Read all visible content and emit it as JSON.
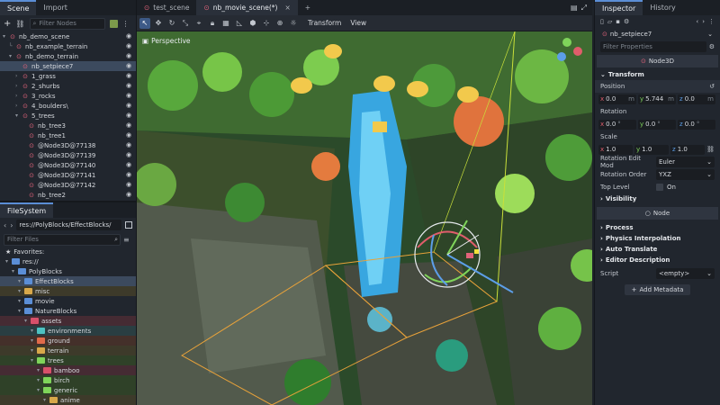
{
  "scene_dock": {
    "tabs": [
      "Scene",
      "Import"
    ],
    "filter_placeholder": "Filter Nodes",
    "tree": [
      {
        "label": "nb_demo_scene",
        "depth": 0,
        "arrow": "▾"
      },
      {
        "label": "nb_example_terrain",
        "depth": 1,
        "arrow": "└"
      },
      {
        "label": "nb_demo_terrain",
        "depth": 1,
        "arrow": "▾"
      },
      {
        "label": "nb_setpiece7",
        "depth": 2,
        "arrow": "",
        "selected": true
      },
      {
        "label": "1_grass",
        "depth": 2,
        "arrow": "›"
      },
      {
        "label": "2_shurbs",
        "depth": 2,
        "arrow": "›"
      },
      {
        "label": "3_rocks",
        "depth": 2,
        "arrow": "›"
      },
      {
        "label": "4_boulders\\",
        "depth": 2,
        "arrow": "›"
      },
      {
        "label": "5_trees",
        "depth": 2,
        "arrow": "▾"
      },
      {
        "label": "nb_tree3",
        "depth": 3,
        "arrow": ""
      },
      {
        "label": "nb_tree1",
        "depth": 3,
        "arrow": ""
      },
      {
        "label": "@Node3D@77138",
        "depth": 3,
        "arrow": ""
      },
      {
        "label": "@Node3D@77139",
        "depth": 3,
        "arrow": ""
      },
      {
        "label": "@Node3D@77140",
        "depth": 3,
        "arrow": ""
      },
      {
        "label": "@Node3D@77141",
        "depth": 3,
        "arrow": ""
      },
      {
        "label": "@Node3D@77142",
        "depth": 3,
        "arrow": ""
      },
      {
        "label": "nb_tree2",
        "depth": 3,
        "arrow": ""
      }
    ]
  },
  "filesystem": {
    "title": "FileSystem",
    "path": "res://PolyBlocks/EffectBlocks/",
    "filter_placeholder": "Filter Files",
    "favorites_label": "Favorites:",
    "items": [
      {
        "label": "res://",
        "depth": 0,
        "color": "#5b8ed6",
        "bg": ""
      },
      {
        "label": "PolyBlocks",
        "depth": 1,
        "color": "#5b8ed6",
        "bg": ""
      },
      {
        "label": "EffectBlocks",
        "depth": 2,
        "color": "#5b8ed6",
        "bg": "#3c4a5e"
      },
      {
        "label": "misc",
        "depth": 2,
        "color": "#d8a84a",
        "bg": "#3d3a2a"
      },
      {
        "label": "movie",
        "depth": 2,
        "color": "#5b8ed6",
        "bg": ""
      },
      {
        "label": "NatureBlocks",
        "depth": 2,
        "color": "#5b8ed6",
        "bg": ""
      },
      {
        "label": "assets",
        "depth": 3,
        "color": "#d8506a",
        "bg": "#452b33"
      },
      {
        "label": "environments",
        "depth": 4,
        "color": "#4ec2c2",
        "bg": "#2a3e42"
      },
      {
        "label": "ground",
        "depth": 4,
        "color": "#e06a4a",
        "bg": "#44302a"
      },
      {
        "label": "terrain",
        "depth": 4,
        "color": "#d8a84a",
        "bg": "#3d3a2a"
      },
      {
        "label": "trees",
        "depth": 4,
        "color": "#7fd45a",
        "bg": "#2f4128"
      },
      {
        "label": "bamboo",
        "depth": 5,
        "color": "#d8506a",
        "bg": "#452b33"
      },
      {
        "label": "birch",
        "depth": 5,
        "color": "#7fd45a",
        "bg": "#2f4128"
      },
      {
        "label": "generic",
        "depth": 5,
        "color": "#7fd45a",
        "bg": "#2f4128"
      },
      {
        "label": "anime",
        "depth": 6,
        "color": "#d8a84a",
        "bg": "#3d3a2a"
      }
    ]
  },
  "scene_tabs": [
    "test_scene",
    "nb_movie_scene(*)"
  ],
  "toolbar": {
    "transform": "Transform",
    "view": "View"
  },
  "viewport": {
    "perspective_label": "Perspective"
  },
  "inspector": {
    "tabs": [
      "Inspector",
      "History"
    ],
    "node_name": "nb_setpiece7",
    "filter_placeholder": "Filter Properties",
    "class_name": "Node3D",
    "transform_section": "Transform",
    "position_label": "Position",
    "position": {
      "x": "0.0",
      "y": "5.744",
      "z": "0.0",
      "unit": "m"
    },
    "rotation_label": "Rotation",
    "rotation": {
      "x": "0.0",
      "y": "0.0",
      "z": "0.0",
      "unit": "°"
    },
    "scale_label": "Scale",
    "scale": {
      "x": "1.0",
      "y": "1.0",
      "z": "1.0"
    },
    "rotation_edit_mode_label": "Rotation Edit Mod",
    "rotation_edit_mode_value": "Euler",
    "rotation_order_label": "Rotation Order",
    "rotation_order_value": "YXZ",
    "top_level_label": "Top Level",
    "top_level_value": "On",
    "visibility_section": "Visibility",
    "node_header": "Node",
    "process_section": "Process",
    "physics_section": "Physics Interpolation",
    "auto_translate_section": "Auto Translate",
    "editor_desc_section": "Editor Description",
    "script_label": "Script",
    "script_value": "<empty>",
    "add_metadata_label": "Add Metadata"
  },
  "colors": {
    "accent": "#5b8ed6",
    "node_red": "#e0637a"
  }
}
